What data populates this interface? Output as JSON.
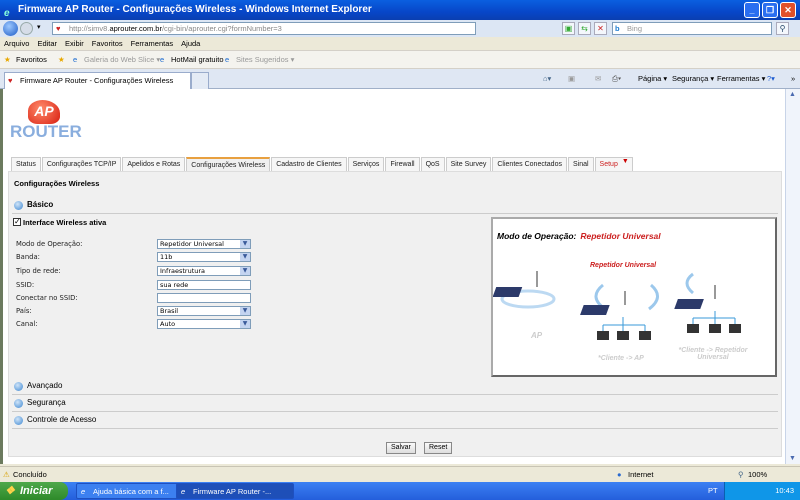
{
  "window": {
    "title": "Firmware AP Router - Configurações Wireless - Windows Internet Explorer"
  },
  "browser": {
    "url_prefix": "http://simv8.",
    "url_domain": "aprouter.com.br",
    "url_path": "/cgi-bin/aprouter.cgi?formNumber=3",
    "search_placeholder": "Bing",
    "menu": [
      "Arquivo",
      "Editar",
      "Exibir",
      "Favoritos",
      "Ferramentas",
      "Ajuda"
    ],
    "favorites_label": "Favoritos",
    "favorites": [
      "Galeria do Web Slice ▾",
      "HotMail gratuito",
      "Sites Sugeridos ▾"
    ],
    "tab_title": "Firmware AP Router - Configurações Wireless",
    "commands": [
      "Página ▾",
      "Segurança ▾",
      "Ferramentas ▾"
    ]
  },
  "page": {
    "logo_ap": "AP",
    "logo_router": "ROUTER",
    "tabs": [
      "Status",
      "Configurações TCP/IP",
      "Apelidos e Rotas",
      "Configurações Wireless",
      "Cadastro de Clientes",
      "Serviços",
      "Firewall",
      "QoS",
      "Site Survey",
      "Clientes Conectados",
      "Sinal",
      "Setup"
    ],
    "panel_title": "Configurações Wireless",
    "sections": {
      "basic": "Básico",
      "advanced": "Avançado",
      "security": "Segurança",
      "access": "Controle de Acesso"
    },
    "wireless_active_label": "Interface Wireless ativa",
    "fields": [
      {
        "label": "Modo de Operação:",
        "value": "Repetidor Universal",
        "type": "select"
      },
      {
        "label": "Banda:",
        "value": "11b",
        "type": "select"
      },
      {
        "label": "Tipo de rede:",
        "value": "Infraestrutura",
        "type": "select"
      },
      {
        "label": "SSID:",
        "value": "sua rede",
        "type": "input"
      },
      {
        "label": "Conectar no SSID:",
        "value": "",
        "type": "input"
      },
      {
        "label": "País:",
        "value": "Brasil",
        "type": "select"
      },
      {
        "label": "Canal:",
        "value": "Auto",
        "type": "select"
      }
    ],
    "diagram": {
      "heading": "Modo de Operação:",
      "mode": "Repetidor Universal",
      "center_label": "Repetidor Universal",
      "ap": "AP",
      "client_ap": "*Cliente -> AP",
      "client_rep": "*Cliente -> Repetidor Universal"
    },
    "save": "Salvar",
    "reset": "Reset"
  },
  "status": {
    "text": "Concluído",
    "zone": "Internet",
    "zoom": "100%"
  },
  "taskbar": {
    "start": "Iniciar",
    "tasks": [
      "Ajuda básica com a f...",
      "Firmware AP Router -..."
    ],
    "lang": "PT",
    "time": "10:43"
  },
  "colors": {
    "accent": "#cc2020",
    "title_bar": "#0746c8"
  }
}
